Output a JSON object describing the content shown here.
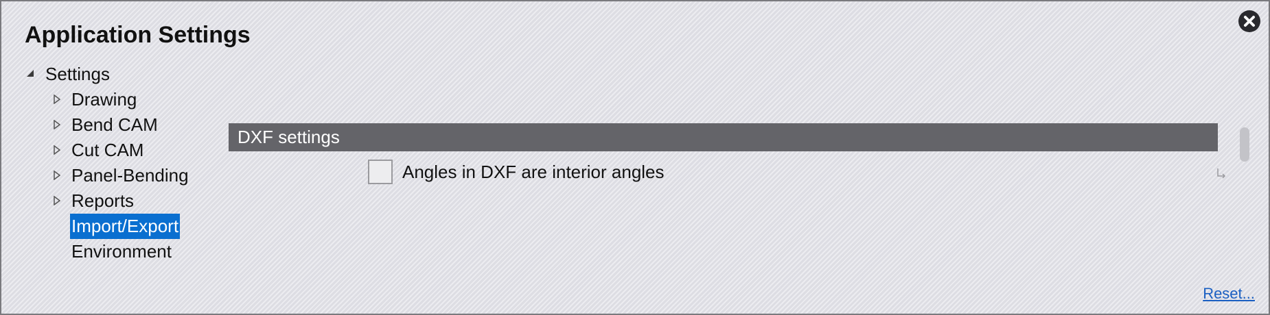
{
  "window": {
    "title": "Application Settings"
  },
  "icons": {
    "close": "close-icon",
    "expanded": "triangle-down-icon",
    "collapsed": "triangle-right-icon",
    "return": "return-arrow-icon"
  },
  "colors": {
    "selection": "#0a6fd0",
    "section_header": "#646469",
    "link": "#1a5fc2"
  },
  "tree": {
    "root": {
      "label": "Settings",
      "expanded": true
    },
    "children": [
      {
        "label": "Drawing",
        "has_children": true
      },
      {
        "label": "Bend CAM",
        "has_children": true
      },
      {
        "label": "Cut CAM",
        "has_children": true
      },
      {
        "label": "Panel-Bending",
        "has_children": true
      },
      {
        "label": "Reports",
        "has_children": true
      },
      {
        "label": "Import/Export",
        "has_children": false,
        "selected": true
      },
      {
        "label": "Environment",
        "has_children": false
      }
    ]
  },
  "content": {
    "section_title": "DXF settings",
    "options": [
      {
        "label": "Angles in DXF are interior angles",
        "checked": false
      }
    ]
  },
  "footer": {
    "reset_label": "Reset..."
  }
}
